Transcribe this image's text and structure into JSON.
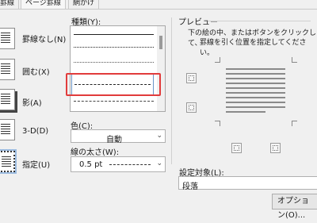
{
  "tabs": [
    {
      "label": "罫線"
    },
    {
      "label": "ページ罫線"
    },
    {
      "label": "網かけ"
    }
  ],
  "settings": {
    "items": [
      {
        "label": "罫線なし(N)",
        "underline": "N"
      },
      {
        "label": "囲む(X)",
        "underline": "X"
      },
      {
        "label": "影(A)",
        "underline": "A"
      },
      {
        "label": "3-D(D)",
        "underline": "D"
      },
      {
        "label": "指定(U)",
        "underline": "U"
      }
    ],
    "selected": "指定(U)"
  },
  "style": {
    "label": "種類(Y):",
    "selected": "dashed"
  },
  "color": {
    "label": "色(C):",
    "value": "自動"
  },
  "width": {
    "label": "線の太さ(W):",
    "value": "0.5 pt"
  },
  "preview": {
    "label": "プレビュー",
    "instruction_line1": "下の絵の中、またはボタンをクリックして、",
    "instruction_line2": "罫線を引く位置を指定してください。"
  },
  "apply_to": {
    "label": "設定対象(L):",
    "value": "段落"
  },
  "buttons": {
    "options": "オプション(O)..."
  },
  "colors": {
    "highlight": "#e13c3c",
    "selection": "#6a95c8"
  }
}
